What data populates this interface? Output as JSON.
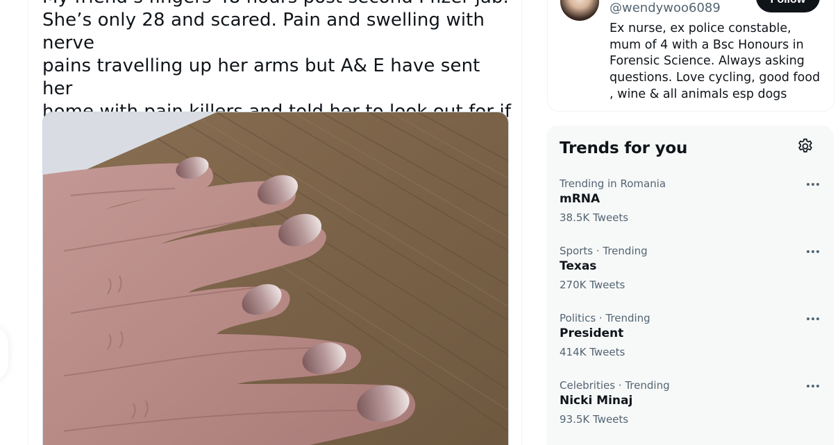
{
  "tweet": {
    "text": "My friend’s fingers 48 hours post second Pfizer jab.\nShe’s only 28 and scared. Pain and swelling with nerve\npains travelling up  her arms but A& E have sent her\nhome with pain killers and told her to look out for if her\ntoenails go black. What the hell are these jabs doing !!!",
    "media_icon": "photo-of-hand-fingers"
  },
  "profile": {
    "handle": "@wendywoo6089",
    "follow_label": "Follow",
    "bio": "Ex nurse, ex police constable, mum of 4 with a Bsc Honours in Forensic Science. Always asking questions. Love cycling, good food , wine & all animals esp dogs"
  },
  "trends": {
    "title": "Trends for you",
    "settings_icon": "gear-icon",
    "more_icon": "ellipsis-icon",
    "items": [
      {
        "context": "Trending in Romania",
        "name": "mRNA",
        "count": "38.5K Tweets"
      },
      {
        "context": "Sports · Trending",
        "name": "Texas",
        "count": "270K Tweets"
      },
      {
        "context": "Politics · Trending",
        "name": "President",
        "count": "414K Tweets"
      },
      {
        "context": "Celebrities · Trending",
        "name": "Nicki Minaj",
        "count": "93.5K Tweets"
      }
    ]
  },
  "colors": {
    "text_primary": "#0f1419",
    "text_secondary": "#536471",
    "panel_bg": "#f7f9f9",
    "follow_bg": "#0f1419"
  }
}
